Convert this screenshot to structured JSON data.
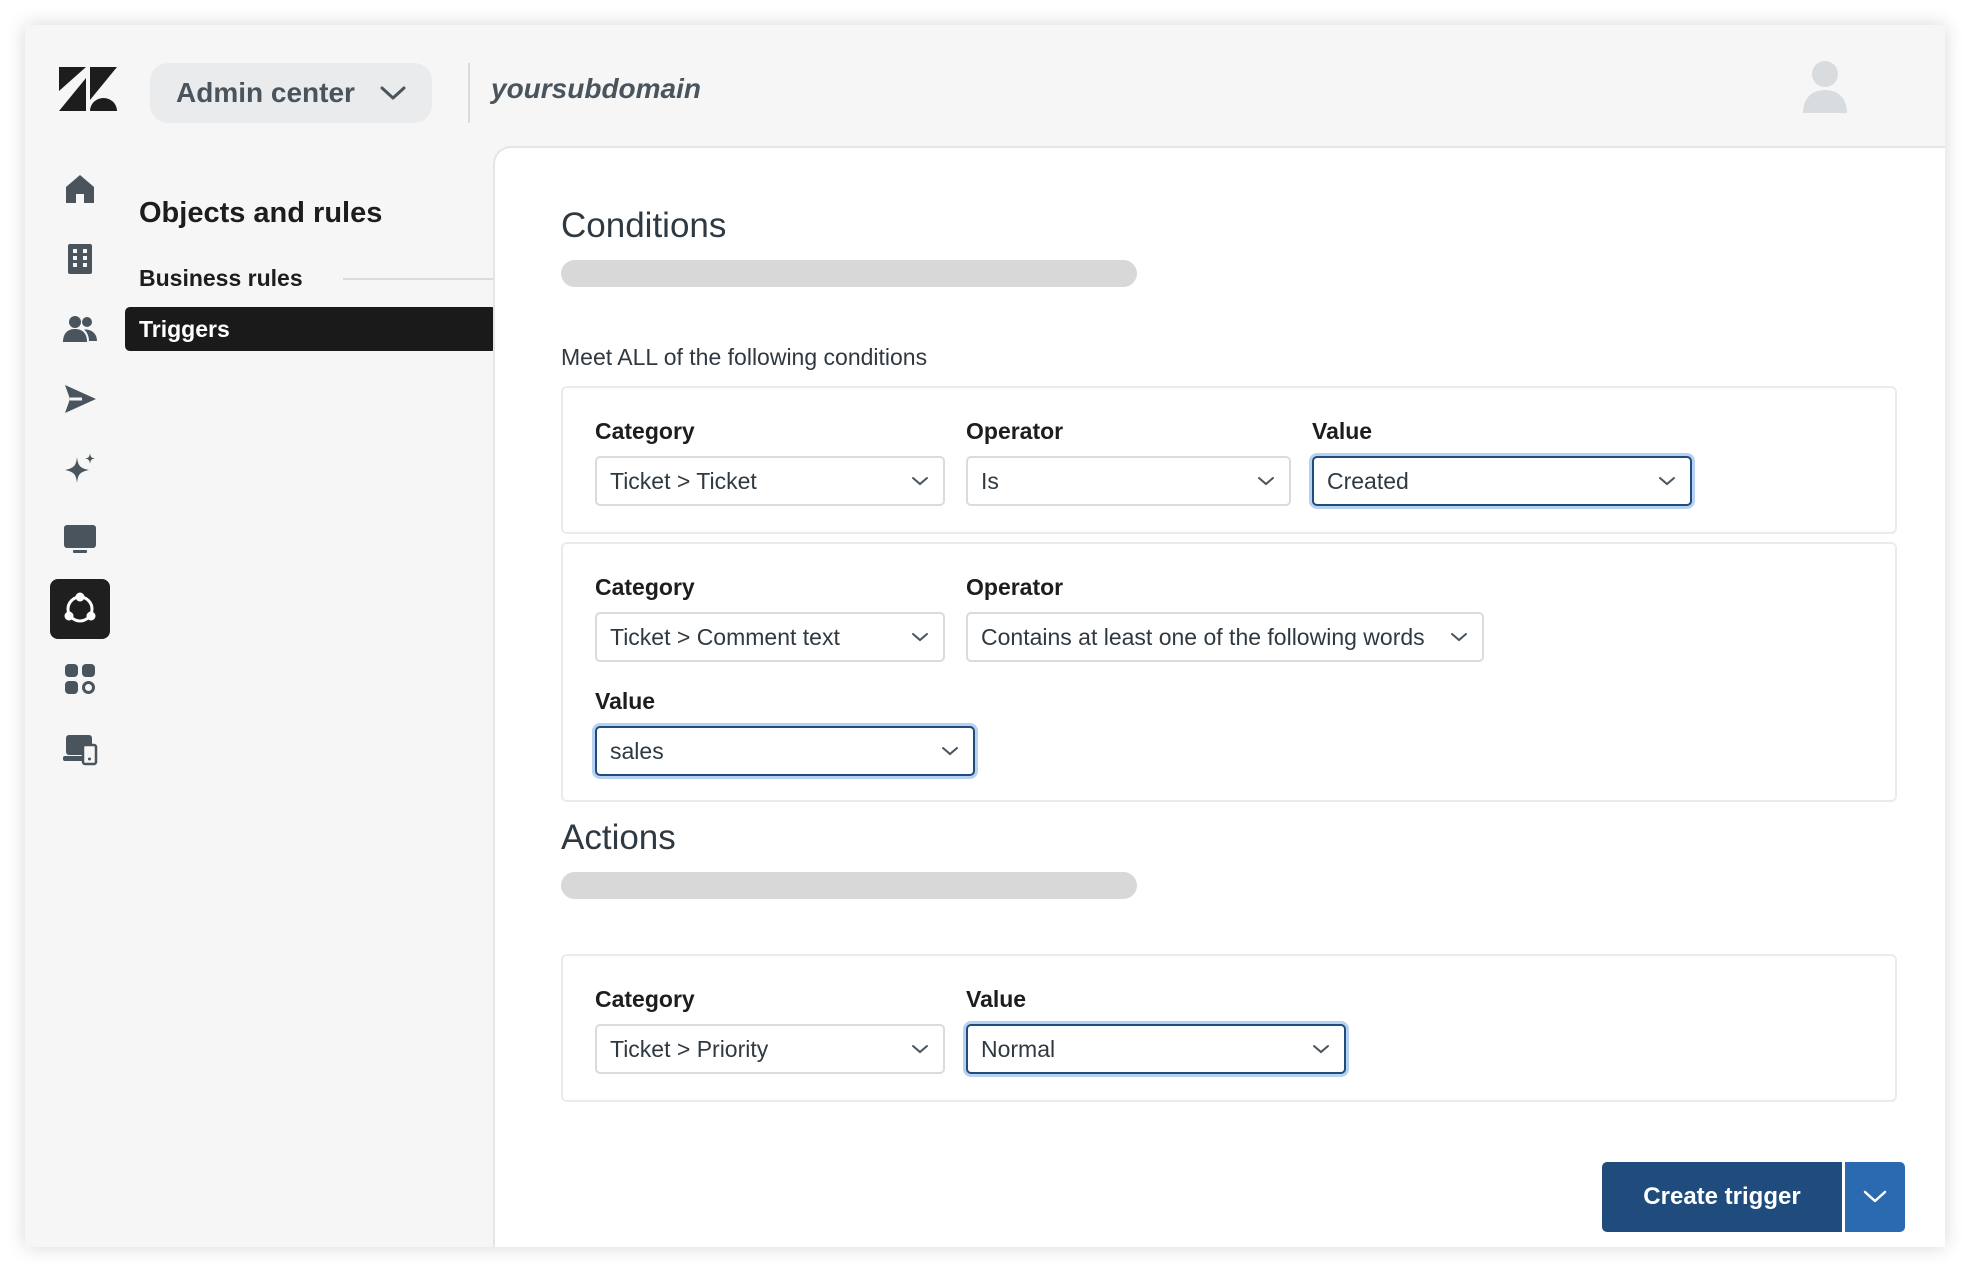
{
  "header": {
    "product": "Admin center",
    "subdomain": "yoursubdomain"
  },
  "rail": {
    "icons": [
      "home-icon",
      "building-icon",
      "people-icon",
      "send-icon",
      "sparkle-icon",
      "monitor-icon",
      "objects-rules-icon",
      "apps-icon",
      "devices-icon"
    ],
    "active": "objects-rules-icon"
  },
  "subnav": {
    "title": "Objects and rules",
    "section": "Business rules",
    "active_item": "Triggers"
  },
  "conditions": {
    "title": "Conditions",
    "meet_label": "Meet ALL of the following conditions",
    "rows": [
      {
        "category_label": "Category",
        "category": "Ticket > Ticket",
        "operator_label": "Operator",
        "operator": "Is",
        "value_label": "Value",
        "value": "Created"
      },
      {
        "category_label": "Category",
        "category": "Ticket > Comment text",
        "operator_label": "Operator",
        "operator": "Contains at least one of the following words",
        "value_label": "Value",
        "value": "sales"
      }
    ]
  },
  "actions": {
    "title": "Actions",
    "rows": [
      {
        "category_label": "Category",
        "category": "Ticket > Priority",
        "value_label": "Value",
        "value": "Normal"
      }
    ]
  },
  "footer": {
    "create_label": "Create trigger"
  },
  "colors": {
    "primary": "#1f4c7c",
    "primary_light": "#2a6ab0",
    "focus_ring": "#b7d2f0",
    "nav_active": "#1a1a1a"
  }
}
